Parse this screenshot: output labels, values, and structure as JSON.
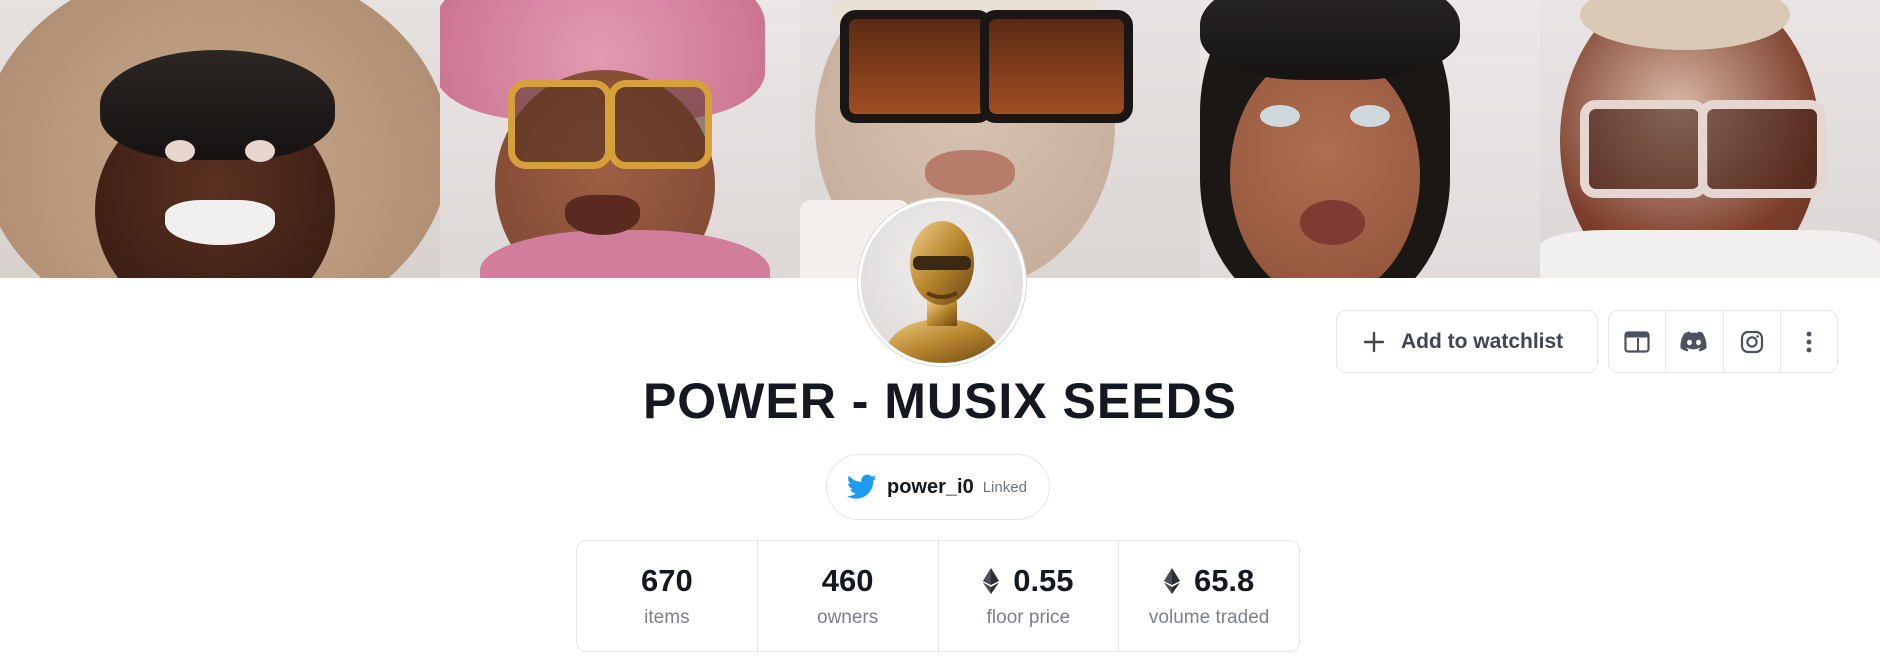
{
  "collection": {
    "title": "POWER - MUSIX SEEDS"
  },
  "twitter": {
    "handle": "power_i0",
    "status": "Linked"
  },
  "stats": [
    {
      "value": "670",
      "label": "items",
      "currency": ""
    },
    {
      "value": "460",
      "label": "owners",
      "currency": ""
    },
    {
      "value": "0.55",
      "label": "floor price",
      "currency": "eth-icon"
    },
    {
      "value": "65.8",
      "label": "volume traded",
      "currency": "eth-icon"
    }
  ],
  "actions": {
    "watchlist_label": "Add to watchlist",
    "icons": [
      "website-icon",
      "discord-icon",
      "instagram-icon",
      "more-icon"
    ]
  },
  "colors": {
    "text_primary": "#141821",
    "text_muted": "#7a818c",
    "border": "#e3e5e8",
    "twitter_blue": "#1d9bf0"
  }
}
